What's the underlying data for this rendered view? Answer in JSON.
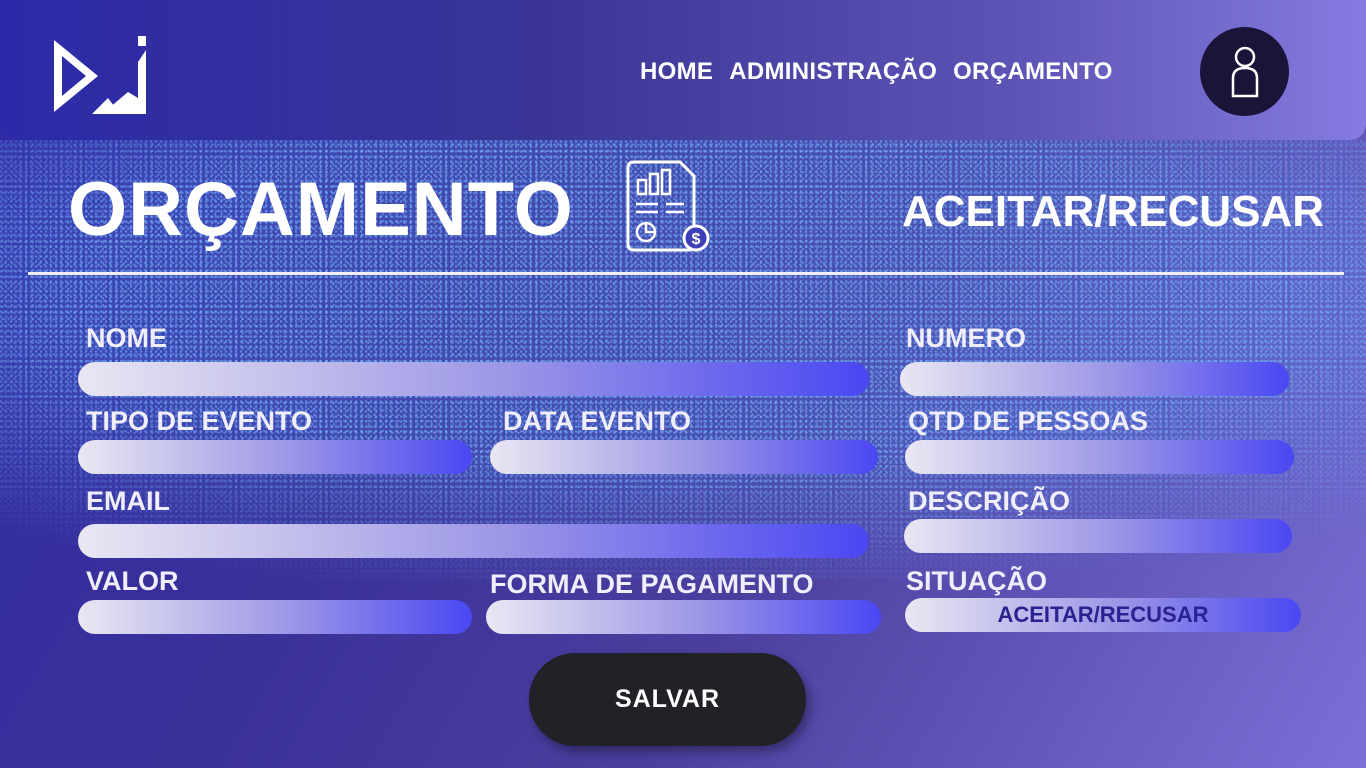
{
  "nav": {
    "home": "HOME",
    "admin": "ADMINISTRAÇÃO",
    "budget": "ORÇAMENTO"
  },
  "page": {
    "title": "ORÇAMENTO",
    "accept_refuse": "ACEITAR/RECUSAR"
  },
  "form": {
    "nome_label": "NOME",
    "numero_label": "NUMERO",
    "tipo_evento_label": "TIPO DE EVENTO",
    "data_evento_label": "DATA EVENTO",
    "qtd_pessoas_label": "QTD DE PESSOAS",
    "email_label": "EMAIL",
    "descricao_label": "DESCRIÇÃO",
    "valor_label": "VALOR",
    "forma_pagamento_label": "FORMA DE PAGAMENTO",
    "situacao_label": "SITUAÇÃO",
    "situacao_value": "ACEITAR/RECUSAR",
    "save_label": "SALVAR"
  },
  "colors": {
    "accent": "#4a47f3",
    "background": "#3a3196",
    "button": "#232128"
  },
  "icons": {
    "logo": "brand-logo-icon",
    "avatar": "user-avatar-icon",
    "document": "budget-document-icon"
  }
}
